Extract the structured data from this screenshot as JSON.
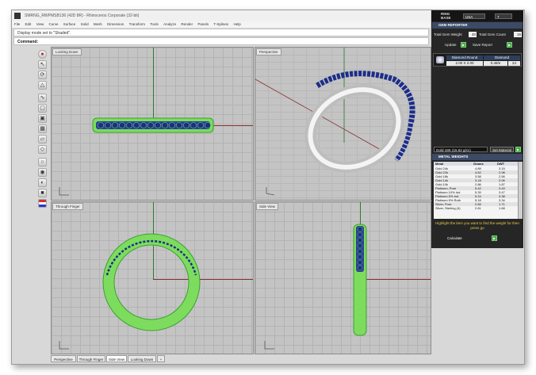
{
  "app": {
    "title": "SMRNG_RWPMSB136 (42D 8R) - Rhinoceros Corporate (32-bit)",
    "menu": [
      "File",
      "Edit",
      "View",
      "Curve",
      "Surface",
      "Solid",
      "Mesh",
      "Dimension",
      "Transform",
      "Tools",
      "Analyze",
      "Render",
      "Panels",
      "T-Splines",
      "Help"
    ],
    "command_history": "Display mode set to \"Shaded\".",
    "command_label": "Command:"
  },
  "toolbar": {
    "icons": [
      "stop-icon",
      "select-icon",
      "rotate-icon",
      "group-icon",
      "curve-tool-icon",
      "box-tool-icon",
      "cube-tool-icon",
      "mesh-tool-icon",
      "solid-tool-icon",
      "surface-tool-icon",
      "view-tool-icon",
      "zoom-tool-icon",
      "render-icon",
      "material-icon",
      "flag-icon"
    ]
  },
  "viewports": {
    "top": {
      "title": "Looking Down"
    },
    "perspective": {
      "title": "Perspective"
    },
    "through": {
      "title": "Through Finger"
    },
    "side": {
      "title": "Side View"
    }
  },
  "tabs": [
    "Perspective",
    "Through Finger",
    "Side View",
    "Looking Down"
  ],
  "tab_add": "+",
  "panel": {
    "logo_line1": "RING",
    "logo_line2": "BASE",
    "region": "USA",
    "count": "7",
    "gem_reporter_title": "GEM REPORTER",
    "total_gem_weight_label": "Total Gem Weight",
    "total_gem_weight": "40",
    "total_gem_count_label": "Total Gem Count",
    "total_gem_count": "16",
    "update_label": "Update",
    "save_report_label": "Save Report",
    "stone_header_a": "Diamond Round",
    "stone_header_b": "Diamond",
    "stone_size": "2.00 X 2.00",
    "stone_weight": "0.48/e",
    "stone_count": "24",
    "material_select": "Gold 18K (15.62 g/cc)",
    "set_material_label": "Set Material",
    "metal_weights_title": "METAL WEIGHTS",
    "metal_headers": [
      "Metal",
      "Grams",
      "DWT"
    ],
    "metals": [
      [
        "Gold 24k",
        "4.89",
        "3.15"
      ],
      [
        "Gold 22k",
        "4.62",
        "2.98"
      ],
      [
        "Gold 18k",
        "3.58",
        "2.56"
      ],
      [
        "Gold 14k",
        "3.18",
        "2.06"
      ],
      [
        "Gold 10k",
        "2.86",
        "1.87"
      ],
      [
        "Platinum, Pure",
        "5.42",
        "3.49"
      ],
      [
        "Platinum 10% Ind",
        "5.39",
        "3.47"
      ],
      [
        "Platinum 5% Ind",
        "5.24",
        "3.38"
      ],
      [
        "Platinum 5% Ruth",
        "5.18",
        "3.34"
      ],
      [
        "Silver, Pure",
        "2.65",
        "1.71"
      ],
      [
        "Silver, Sterling (4)",
        "2.61",
        "1.68"
      ]
    ],
    "highlight_note": "Highlight the item you want to find the weight for then press go",
    "calculate_label": "Calculate",
    "colors": {
      "panel_bg": "#262626",
      "section_blue": "#3c4a66",
      "go_green": "#3da83d",
      "note_yellow": "#e8cc4a"
    }
  },
  "scene_colors": {
    "ring_green": "#7ddc5e",
    "gem_blue": "#1c2d8a",
    "metal_silver": "#d8d8d8",
    "axis_red": "#8a3030",
    "axis_green": "#2f7a2f"
  }
}
